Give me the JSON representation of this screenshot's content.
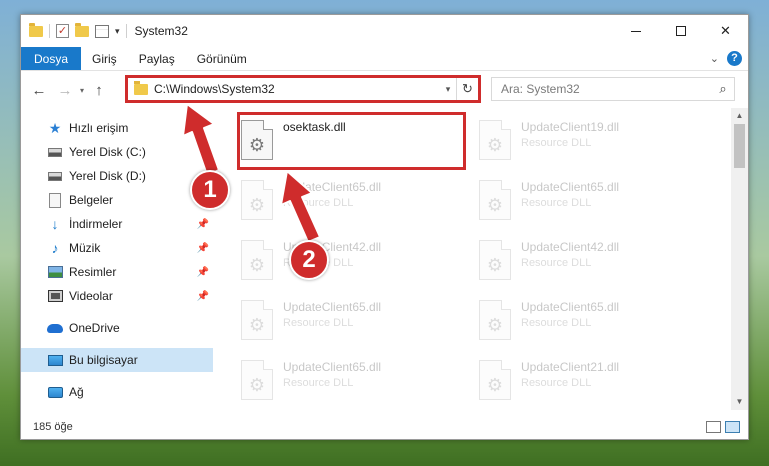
{
  "window": {
    "title": "System32",
    "controls": {
      "minimize": "minimize",
      "maximize": "maximize",
      "close": "✕"
    }
  },
  "ribbon": {
    "tabs": [
      {
        "label": "Dosya"
      },
      {
        "label": "Giriş"
      },
      {
        "label": "Paylaş"
      },
      {
        "label": "Görünüm"
      }
    ],
    "help": "?"
  },
  "nav": {
    "address": "C:\\Windows\\System32",
    "search_placeholder": "Ara: System32"
  },
  "sidebar": {
    "items": [
      {
        "label": "Hızlı erişim",
        "icon": "star-icon"
      },
      {
        "label": "Yerel Disk (C:)",
        "icon": "drive-icon"
      },
      {
        "label": "Yerel Disk (D:)",
        "icon": "drive-icon"
      },
      {
        "label": "Belgeler",
        "icon": "document-icon"
      },
      {
        "label": "İndirmeler",
        "icon": "download-icon"
      },
      {
        "label": "Müzik",
        "icon": "music-icon"
      },
      {
        "label": "Resimler",
        "icon": "picture-icon"
      },
      {
        "label": "Videolar",
        "icon": "video-icon"
      },
      {
        "label": "OneDrive",
        "icon": "cloud-icon"
      },
      {
        "label": "Bu bilgisayar",
        "icon": "computer-icon"
      },
      {
        "label": "Ağ",
        "icon": "network-icon"
      }
    ]
  },
  "files": [
    {
      "name": "osektask.dll",
      "type": ""
    },
    {
      "name": "UpdateClient19.dll",
      "type": "Resource DLL"
    },
    {
      "name": "UpdateClient65.dll",
      "type": "Resource DLL"
    },
    {
      "name": "UpdateClient65.dll",
      "type": "Resource DLL"
    },
    {
      "name": "UpdateClient42.dll",
      "type": "Resource DLL"
    },
    {
      "name": "UpdateClient42.dll",
      "type": "Resource DLL"
    },
    {
      "name": "UpdateClient65.dll",
      "type": "Resource DLL"
    },
    {
      "name": "UpdateClient65.dll",
      "type": "Resource DLL"
    },
    {
      "name": "UpdateClient65.dll",
      "type": "Resource DLL"
    },
    {
      "name": "UpdateClient21.dll",
      "type": "Resource DLL"
    }
  ],
  "status": {
    "count": "185 öğe"
  },
  "annotations": {
    "step1": "1",
    "step2": "2",
    "color": "#cf2c2c"
  }
}
